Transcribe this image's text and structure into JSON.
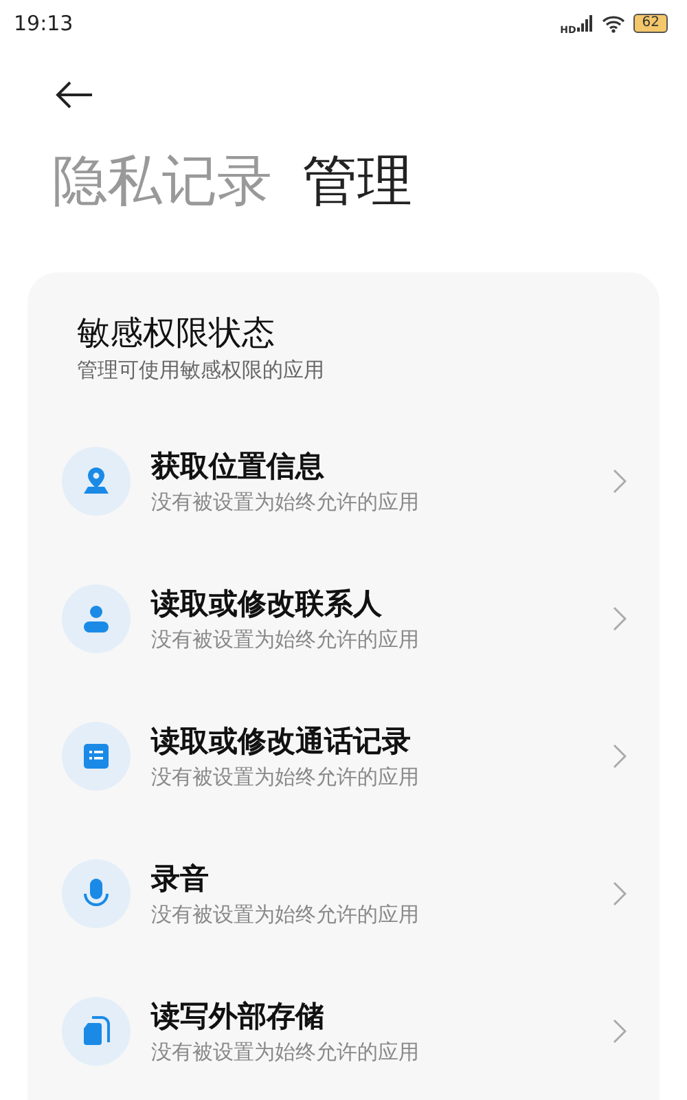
{
  "status_bar": {
    "time": "19:13",
    "network": "HD",
    "battery": "62"
  },
  "header": {
    "tabs": [
      {
        "label": "隐私记录",
        "selected": false
      },
      {
        "label": "管理",
        "selected": true
      }
    ]
  },
  "card": {
    "title": "敏感权限状态",
    "subtitle": "管理可使用敏感权限的应用",
    "items": [
      {
        "kind": "location",
        "title": "获取位置信息",
        "subtitle": "没有被设置为始终允许的应用"
      },
      {
        "kind": "contact",
        "title": "读取或修改联系人",
        "subtitle": "没有被设置为始终允许的应用"
      },
      {
        "kind": "calllog",
        "title": "读取或修改通话记录",
        "subtitle": "没有被设置为始终允许的应用"
      },
      {
        "kind": "mic",
        "title": "录音",
        "subtitle": "没有被设置为始终允许的应用"
      },
      {
        "kind": "storage",
        "title": "读写外部存储",
        "subtitle": "没有被设置为始终允许的应用"
      }
    ]
  }
}
